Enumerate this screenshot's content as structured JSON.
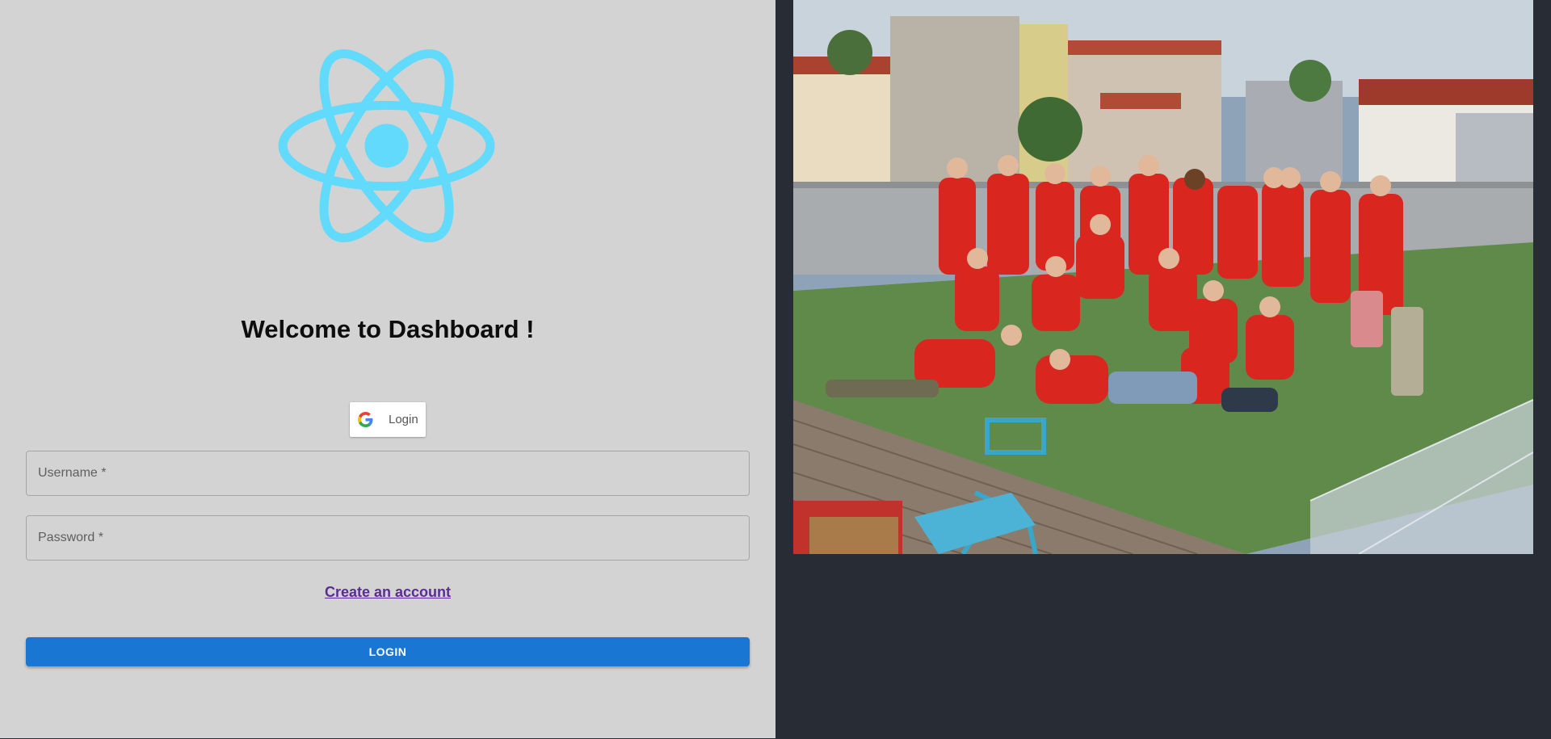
{
  "heading": "Welcome to Dashboard !",
  "google_login": {
    "label": "Login",
    "icon": "google-icon"
  },
  "form": {
    "username_label": "Username *",
    "password_label": "Password *"
  },
  "create_account": "Create an account",
  "login_button": "LOGIN",
  "logo": {
    "icon": "react-atom-icon",
    "color": "#61dafb"
  },
  "photo": {
    "description_icon": "team-photo-image"
  },
  "colors": {
    "left_panel": "#d3d3d3",
    "right_panel": "#282c34",
    "primary": "#1976d2",
    "link": "#5b2a9a"
  }
}
